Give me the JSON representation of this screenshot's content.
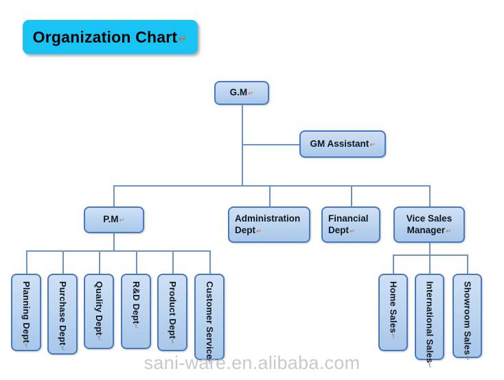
{
  "title": {
    "text": "Organization Chart",
    "mark": "↵",
    "background_color": "#19c4f5"
  },
  "theme": {
    "node_border_color": "#4879bd",
    "node_fill_top": "#cfe0f4",
    "node_fill_bottom": "#a8c7ea",
    "connector_color": "#6a93c0",
    "page_background": "#ffffff",
    "watermark_color": "#c9c9c9"
  },
  "watermark": {
    "text": "sani-ware.en.alibaba.com"
  },
  "nodes": {
    "gm": {
      "label": "G.M",
      "mark": "↵"
    },
    "gm_assistant": {
      "label": "GM Assistant",
      "mark": "↵"
    },
    "pm": {
      "label": "P.M",
      "mark": "↵"
    },
    "administration": {
      "label": "Administration Dept",
      "mark": "↵"
    },
    "financial": {
      "label": "Financial Dept",
      "mark": "↵"
    },
    "vice_sales": {
      "label": "Vice  Sales Manager",
      "mark": "↵"
    },
    "planning": {
      "label": "Planning Dept",
      "mark": "↵"
    },
    "purchase": {
      "label": "Purchase Dept",
      "mark": "↵"
    },
    "quality": {
      "label": "Quality Dept",
      "mark": "↵"
    },
    "rnd": {
      "label": "R&D Dept",
      "mark": "↵"
    },
    "product": {
      "label": "Product Dept",
      "mark": "↵"
    },
    "customer_service": {
      "label": "Customer Service",
      "mark": "↵"
    },
    "home_sales": {
      "label": "Home Sales",
      "mark": "↵"
    },
    "international_sales": {
      "label": "International Sales",
      "mark": "↵"
    },
    "showroom_sales": {
      "label": "Showroom Sales",
      "mark": "↵"
    }
  }
}
